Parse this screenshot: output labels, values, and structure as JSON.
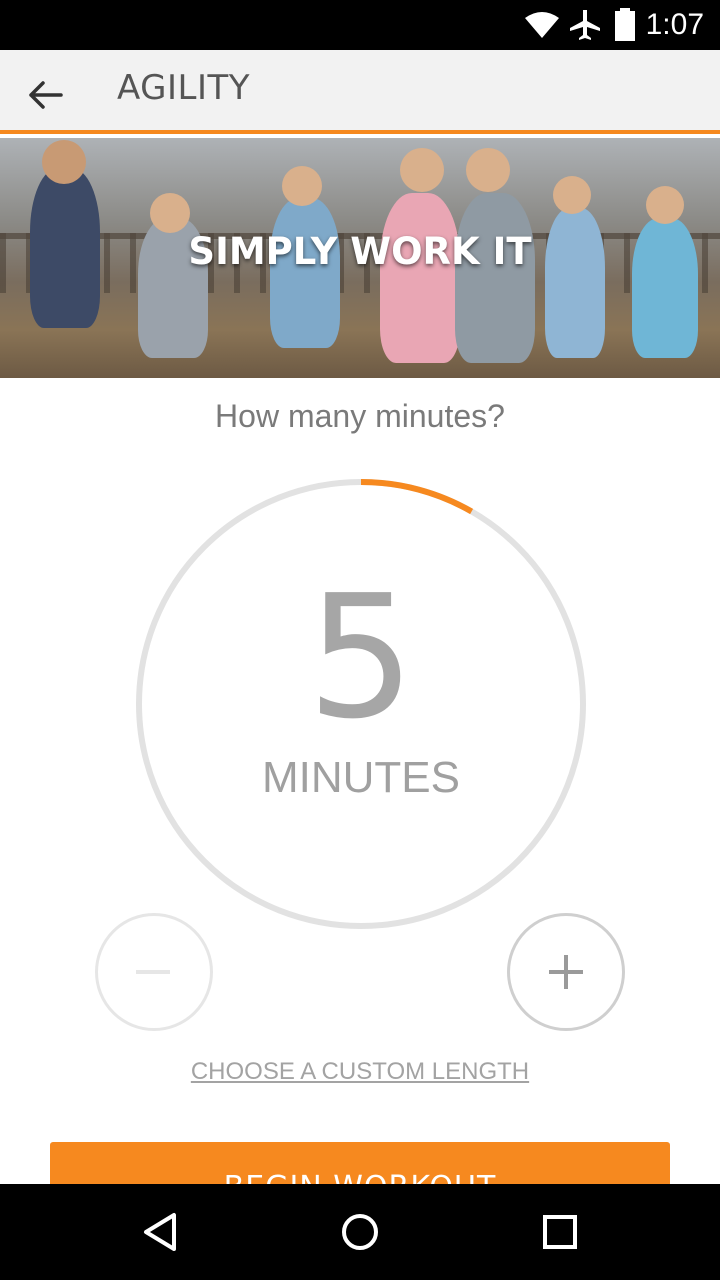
{
  "status_bar": {
    "time": "1:07",
    "icons": [
      "wifi-icon",
      "airplane-icon",
      "battery-icon"
    ]
  },
  "app_bar": {
    "title": "AGILITY",
    "back_icon": "arrow-left-icon"
  },
  "hero": {
    "title": "SIMPLY WORK IT"
  },
  "question": "How many minutes?",
  "dial": {
    "value": "5",
    "unit": "MINUTES",
    "progress_fraction": 0.083
  },
  "stepper": {
    "minus_label": "−",
    "plus_label": "+"
  },
  "custom_length_link": "CHOOSE A CUSTOM LENGTH",
  "begin_button": "BEGIN WORKOUT",
  "colors": {
    "accent": "#f6891f",
    "ring_track": "#e2e2e2",
    "text_gray": "#a6a6a6"
  },
  "nav_bar": {
    "icons": [
      "back-triangle-icon",
      "home-circle-icon",
      "recents-square-icon"
    ]
  }
}
